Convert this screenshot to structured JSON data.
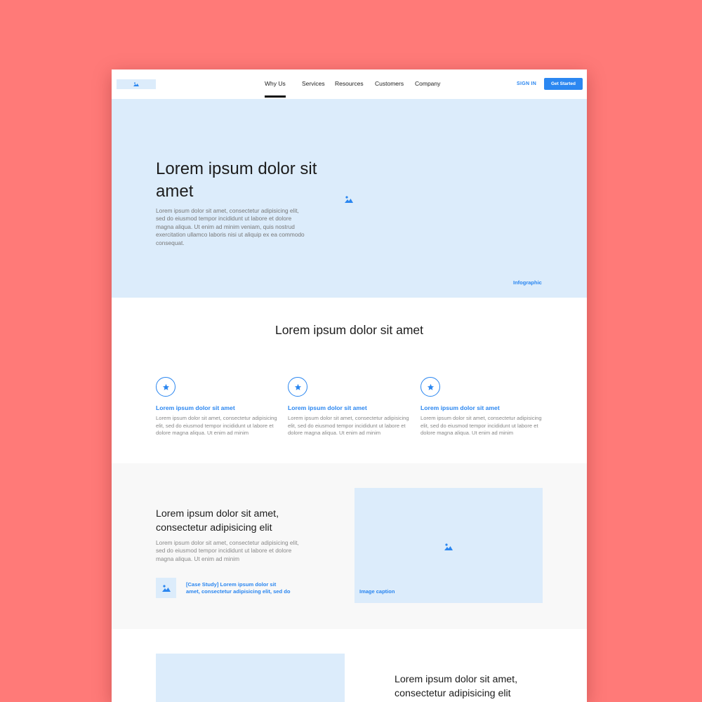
{
  "nav": {
    "items": [
      {
        "label": "Why Us",
        "active": true
      },
      {
        "label": "Services"
      },
      {
        "label": "Resources"
      },
      {
        "label": "Customers"
      },
      {
        "label": "Company"
      }
    ],
    "signin": "SIGN IN",
    "cta": "Get Started"
  },
  "hero": {
    "title": "Lorem ipsum dolor sit amet",
    "body": "Lorem ipsum dolor sit amet, consectetur adipisicing elit, sed do eiusmod tempor incididunt ut labore et dolore magna aliqua. Ut enim ad minim veniam, quis nostrud exercitation ullamco laboris nisi ut aliquip ex ea commodo consequat.",
    "image_caption": "Infographic"
  },
  "features": {
    "title": "Lorem ipsum dolor sit amet",
    "items": [
      {
        "heading": "Lorem ipsum dolor sit amet",
        "body": "Lorem ipsum dolor sit amet, consectetur adipisicing elit, sed do eiusmod tempor incididunt ut labore et dolore magna aliqua. Ut enim ad minim",
        "icon": "star-icon"
      },
      {
        "heading": "Lorem ipsum dolor sit amet",
        "body": "Lorem ipsum dolor sit amet, consectetur adipisicing elit, sed do eiusmod tempor incididunt ut labore et dolore magna aliqua. Ut enim ad minim",
        "icon": "star-icon"
      },
      {
        "heading": "Lorem ipsum dolor sit amet",
        "body": "Lorem ipsum dolor sit amet, consectetur adipisicing elit, sed do eiusmod tempor incididunt ut labore et dolore magna aliqua. Ut enim ad minim",
        "icon": "star-icon"
      }
    ]
  },
  "case_section": {
    "title": "Lorem ipsum dolor sit amet, consectetur adipisicing elit",
    "body": "Lorem ipsum dolor sit amet, consectetur adipisicing elit, sed do eiusmod tempor incididunt ut labore et dolore magna aliqua. Ut enim ad minim",
    "link": "[Case Study] Lorem ipsum dolor sit amet, consectetur adipisicing elit, sed do",
    "image_caption": "Image caption"
  },
  "bottom_section": {
    "title": "Lorem ipsum dolor sit amet, consectetur adipisicing elit"
  },
  "colors": {
    "background": "#ff7a78",
    "accent": "#2a86f0",
    "placeholder": "#dcecfb"
  }
}
